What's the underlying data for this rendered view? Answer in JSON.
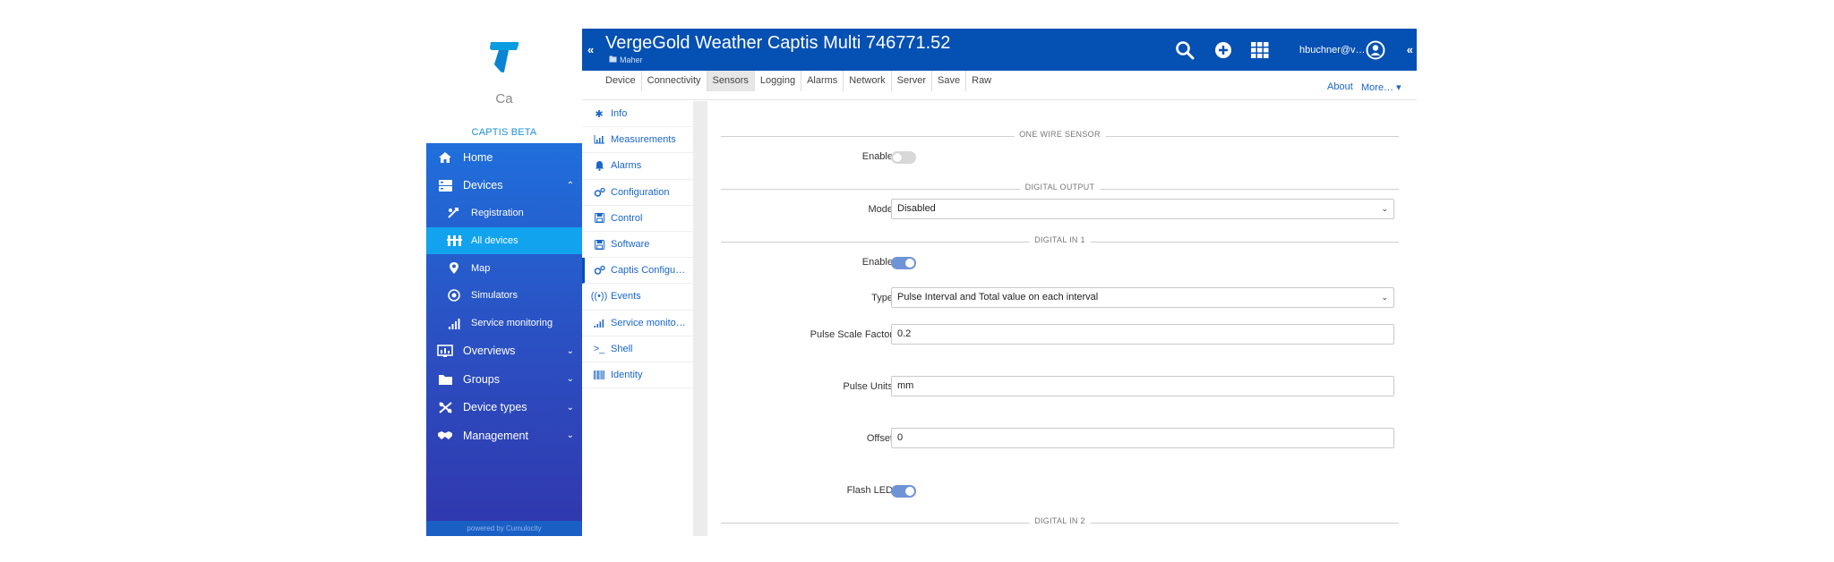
{
  "brand": {
    "tenant": "Ca",
    "app_name": "CAPTIS BETA",
    "powered": "powered by Cumulocity",
    "logo_color": "#0a9ce0"
  },
  "nav": {
    "items": [
      {
        "id": "home",
        "label": "Home",
        "icon": "home-icon"
      },
      {
        "id": "devices",
        "label": "Devices",
        "icon": "devices-icon",
        "expanded": true
      },
      {
        "id": "registration",
        "label": "Registration",
        "icon": "registration-icon",
        "sub": true
      },
      {
        "id": "all-devices",
        "label": "All devices",
        "icon": "all-devices-icon",
        "sub": true,
        "active": true
      },
      {
        "id": "map",
        "label": "Map",
        "icon": "map-pin-icon",
        "sub": true
      },
      {
        "id": "simulators",
        "label": "Simulators",
        "icon": "simulators-icon",
        "sub": true
      },
      {
        "id": "service-monitoring",
        "label": "Service monitoring",
        "icon": "signal-bars-icon",
        "sub": true
      },
      {
        "id": "overviews",
        "label": "Overviews",
        "icon": "overviews-icon"
      },
      {
        "id": "groups",
        "label": "Groups",
        "icon": "folder-icon"
      },
      {
        "id": "device-types",
        "label": "Device types",
        "icon": "device-types-icon"
      },
      {
        "id": "management",
        "label": "Management",
        "icon": "handshake-icon"
      }
    ],
    "colors": {
      "active": "#12a3ee",
      "gradient_top": "#1f6fdb",
      "gradient_bottom": "#3137ad"
    }
  },
  "header": {
    "title": "VergeGold Weather Captis Multi 746771.52",
    "subtitle": "Maher",
    "user": "hbuchner@v…",
    "background": "#0550b3",
    "icons": [
      "search-icon",
      "add-icon",
      "app-grid-icon",
      "user-icon"
    ]
  },
  "tabs": {
    "items": [
      "Device",
      "Connectivity",
      "Sensors",
      "Logging",
      "Alarms",
      "Network",
      "Server",
      "Save",
      "Raw"
    ],
    "active": "Sensors",
    "about": "About",
    "more": "More…"
  },
  "subnav": {
    "items": [
      {
        "label": "Info",
        "icon": "asterisk-icon"
      },
      {
        "label": "Measurements",
        "icon": "bar-chart-icon"
      },
      {
        "label": "Alarms",
        "icon": "bell-icon"
      },
      {
        "label": "Configuration",
        "icon": "gears-icon"
      },
      {
        "label": "Control",
        "icon": "floppy-icon"
      },
      {
        "label": "Software",
        "icon": "floppy-icon"
      },
      {
        "label": "Captis Configu…",
        "icon": "gears-icon",
        "active": true
      },
      {
        "label": "Events",
        "icon": "broadcast-icon"
      },
      {
        "label": "Service monito…",
        "icon": "signal-bars-icon"
      },
      {
        "label": "Shell",
        "icon": "terminal-icon"
      },
      {
        "label": "Identity",
        "icon": "barcode-icon"
      }
    ]
  },
  "form": {
    "one_wire": {
      "title": "ONE WIRE SENSOR",
      "enable_label": "Enable",
      "enable": false
    },
    "digital_output": {
      "title": "DIGITAL OUTPUT",
      "mode_label": "Mode",
      "mode": "Disabled"
    },
    "digital_in_1": {
      "title": "DIGITAL IN 1",
      "enable_label": "Enable",
      "enable": true,
      "type_label": "Type",
      "type": "Pulse Interval and Total value on each interval",
      "scale_label": "Pulse Scale Factor",
      "scale": "0.2",
      "units_label": "Pulse Units",
      "units": "mm",
      "offset_label": "Offset",
      "offset": "0",
      "flash_label": "Flash LED",
      "flash": true
    },
    "digital_in_2": {
      "title": "DIGITAL IN 2"
    }
  }
}
